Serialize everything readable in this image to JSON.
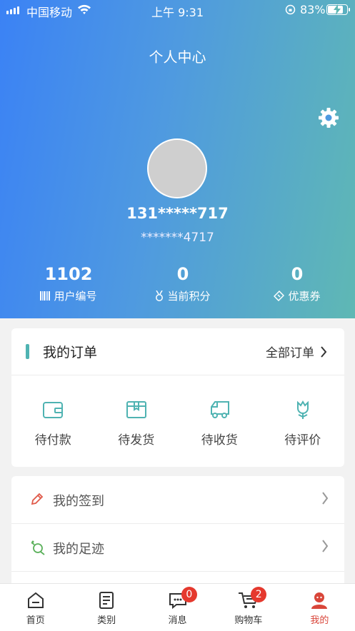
{
  "status": {
    "carrier": "中国移动",
    "time": "上午 9:31",
    "battery": "83%"
  },
  "header": {
    "title": "个人中心"
  },
  "profile": {
    "phone": "131*****717",
    "masked_id": "*******4717"
  },
  "stats": [
    {
      "value": "1102",
      "label": "用户编号",
      "icon": "barcode-icon"
    },
    {
      "value": "0",
      "label": "当前积分",
      "icon": "medal-icon"
    },
    {
      "value": "0",
      "label": "优惠券",
      "icon": "coupon-icon"
    }
  ],
  "orders": {
    "title": "我的订单",
    "all_label": "全部订单",
    "items": [
      {
        "label": "待付款",
        "icon": "wallet-icon"
      },
      {
        "label": "待发货",
        "icon": "box-icon"
      },
      {
        "label": "待收货",
        "icon": "truck-icon"
      },
      {
        "label": "待评价",
        "icon": "flower-icon"
      }
    ]
  },
  "menu": [
    {
      "label": "我的签到",
      "icon": "pencil-icon"
    },
    {
      "label": "我的足迹",
      "icon": "footprint-icon"
    }
  ],
  "tabs": [
    {
      "label": "首页",
      "icon": "home-icon"
    },
    {
      "label": "类别",
      "icon": "list-icon"
    },
    {
      "label": "消息",
      "icon": "message-icon",
      "badge": "0"
    },
    {
      "label": "购物车",
      "icon": "cart-icon",
      "badge": "2"
    },
    {
      "label": "我的",
      "icon": "profile-icon"
    }
  ],
  "colors": {
    "accent": "#4fb3b2",
    "active_tab": "#d9463a",
    "badge": "#e5392e"
  }
}
